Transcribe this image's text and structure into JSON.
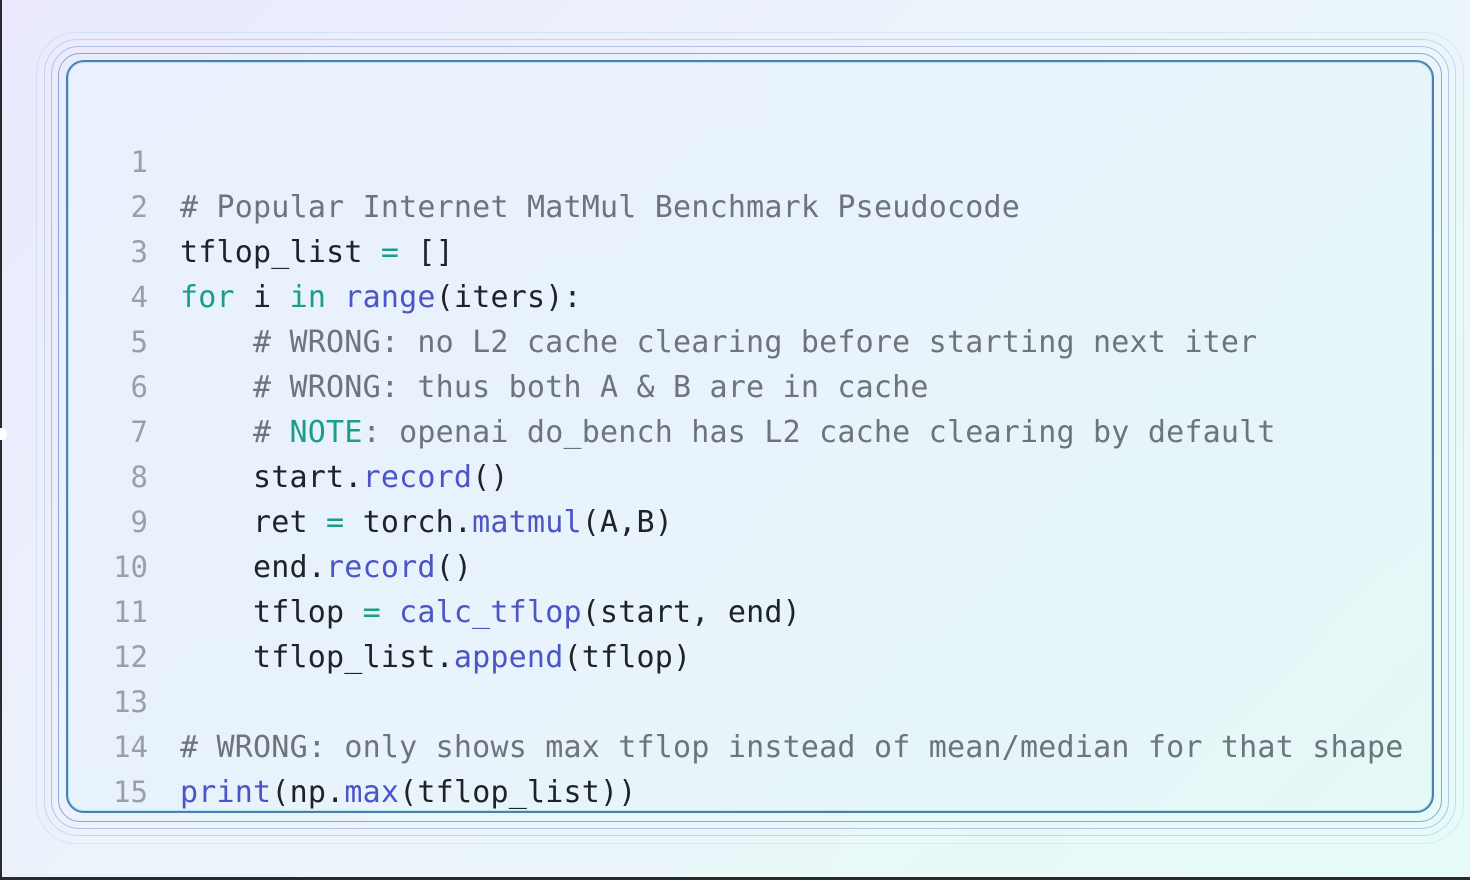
{
  "colors": {
    "comment": "#6e747c",
    "keyword": "#1a9e8a",
    "function": "#4b55c8",
    "text": "#1f2328",
    "line_number": "#9aa0a8",
    "panel_border": "#4a7fb8"
  },
  "code": {
    "line_numbers": [
      "1",
      "2",
      "3",
      "4",
      "5",
      "6",
      "7",
      "8",
      "9",
      "10",
      "11",
      "12",
      "13",
      "14",
      "15"
    ],
    "l1": {
      "comment": "# Popular Internet MatMul Benchmark Pseudocode"
    },
    "l2": {
      "var": "tflop_list ",
      "op": "=",
      "rest": " []"
    },
    "l3": {
      "kw_for": "for",
      "var": " i ",
      "kw_in": "in",
      "sp": " ",
      "fn": "range",
      "rest": "(iters):"
    },
    "l4": {
      "comment": "# WRONG: no L2 cache clearing before starting next iter"
    },
    "l5": {
      "comment": "# WRONG: thus both A & B are in cache"
    },
    "l6": {
      "hash": "# ",
      "note": "NOTE",
      "comment": ": openai do_bench has L2 cache clearing by default"
    },
    "l7": {
      "obj": "start.",
      "fn": "record",
      "rest": "()"
    },
    "l8": {
      "var": "ret ",
      "op": "=",
      "obj": " torch.",
      "fn": "matmul",
      "rest": "(A,B)"
    },
    "l9": {
      "obj": "end.",
      "fn": "record",
      "rest": "()"
    },
    "l10": {
      "var": "tflop ",
      "op": "=",
      "sp": " ",
      "fn": "calc_tflop",
      "rest": "(start, end)"
    },
    "l11": {
      "obj": "tflop_list.",
      "fn": "append",
      "rest": "(tflop)"
    },
    "l13": {
      "comment": "# WRONG: only shows max tflop instead of mean/median for that shape"
    },
    "l14": {
      "fn": "print",
      "pre": "(np.",
      "fn2": "max",
      "rest": "(tflop_list))"
    }
  }
}
